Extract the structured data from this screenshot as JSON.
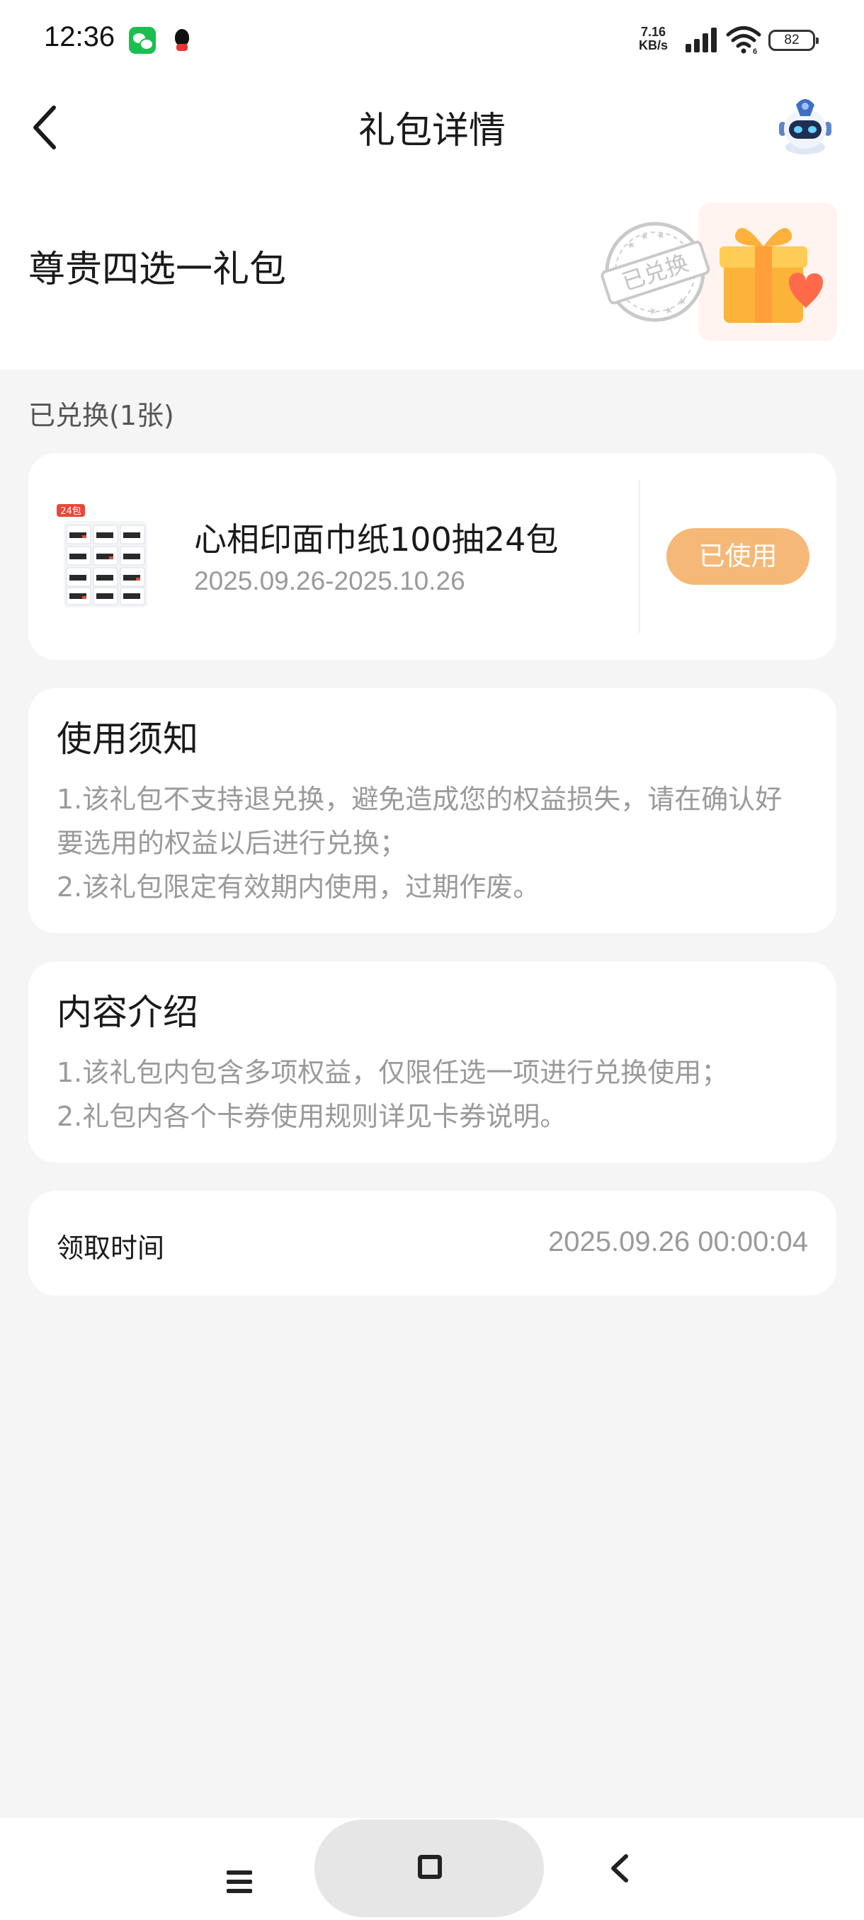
{
  "status_bar": {
    "time": "12:36",
    "net_speed_value": "7.16",
    "net_speed_unit": "KB/s",
    "wifi_label": "6",
    "battery": "82",
    "app_icons": [
      "wechat-icon",
      "qq-icon"
    ]
  },
  "nav": {
    "title": "礼包详情",
    "back_icon": "back-arrow-icon",
    "avatar_icon": "robot-avatar-icon"
  },
  "gift": {
    "name": "尊贵四选一礼包",
    "stamp_text": "已兑换",
    "image_icon": "gift-box-icon"
  },
  "section": {
    "redeemed_label": "已兑换(1张)"
  },
  "coupon": {
    "title": "心相印面巾纸100抽24包",
    "date_range": "2025.09.26-2025.10.26",
    "badge": "24包",
    "status_button": "已使用"
  },
  "notice": {
    "heading": "使用须知",
    "lines": [
      "1.该礼包不支持退兑换，避免造成您的权益损失，请在确认好要选用的权益以后进行兑换；",
      "2.该礼包限定有效期内使用，过期作废。"
    ]
  },
  "intro": {
    "heading": "内容介绍",
    "lines": [
      "1.该礼包内包含多项权益，仅限任选一项进行兑换使用；",
      "2.礼包内各个卡券使用规则详见卡券说明。"
    ]
  },
  "receive": {
    "label": "领取时间",
    "value": "2025.09.26 00:00:04"
  },
  "bottom_nav": {
    "icons": [
      "menu-icon",
      "home-icon",
      "back-icon"
    ]
  },
  "colors": {
    "background": "#f5f5f5",
    "card": "#ffffff",
    "used_button": "#f6b877",
    "muted_text": "#9a9a9a"
  }
}
